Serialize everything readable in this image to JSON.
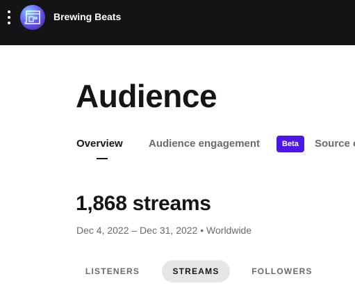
{
  "header": {
    "artist_name": "Brewing Beats",
    "menu_icon": "kebab-menu-icon",
    "avatar_icon": "artist-avatar"
  },
  "page": {
    "title": "Audience"
  },
  "tabs": [
    {
      "label": "Overview",
      "active": true
    },
    {
      "label": "Audience engagement",
      "active": false
    },
    {
      "label": "Source of streams",
      "active": false
    }
  ],
  "badge": {
    "label": "Beta",
    "color": "#4d16e8"
  },
  "summary": {
    "count": "1,868 streams",
    "date_range": "Dec 4, 2022 – Dec 31, 2022",
    "separator": "•",
    "region": "Worldwide"
  },
  "metric_toggle": [
    {
      "label": "LISTENERS",
      "active": false
    },
    {
      "label": "STREAMS",
      "active": true
    },
    {
      "label": "FOLLOWERS",
      "active": false
    }
  ],
  "colors": {
    "topbar": "#141414",
    "text_primary": "#191414",
    "text_secondary": "#6a6a6a",
    "pill_active": "#e6e6e6"
  }
}
